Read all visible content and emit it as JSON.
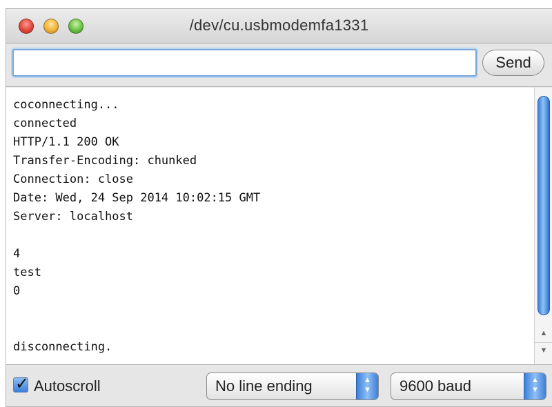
{
  "window": {
    "title": "/dev/cu.usbmodemfa1331"
  },
  "input_row": {
    "input_value": "",
    "input_placeholder": "",
    "send_label": "Send"
  },
  "console": {
    "lines": [
      "coconnecting...",
      "connected",
      "HTTP/1.1 200 OK",
      "Transfer-Encoding: chunked",
      "Connection: close",
      "Date: Wed, 24 Sep 2014 10:02:15 GMT",
      "Server: localhost",
      "",
      "4",
      "test",
      "0",
      "",
      "",
      "disconnecting."
    ]
  },
  "status_bar": {
    "autoscroll_checked": true,
    "autoscroll_label": "Autoscroll",
    "line_ending_selected": "No line ending",
    "baud_selected": "9600 baud"
  },
  "colors": {
    "accent": "#3d7fd8",
    "traffic_red": "#e2473b",
    "traffic_yellow": "#f0b33a",
    "traffic_green": "#6bc144"
  }
}
